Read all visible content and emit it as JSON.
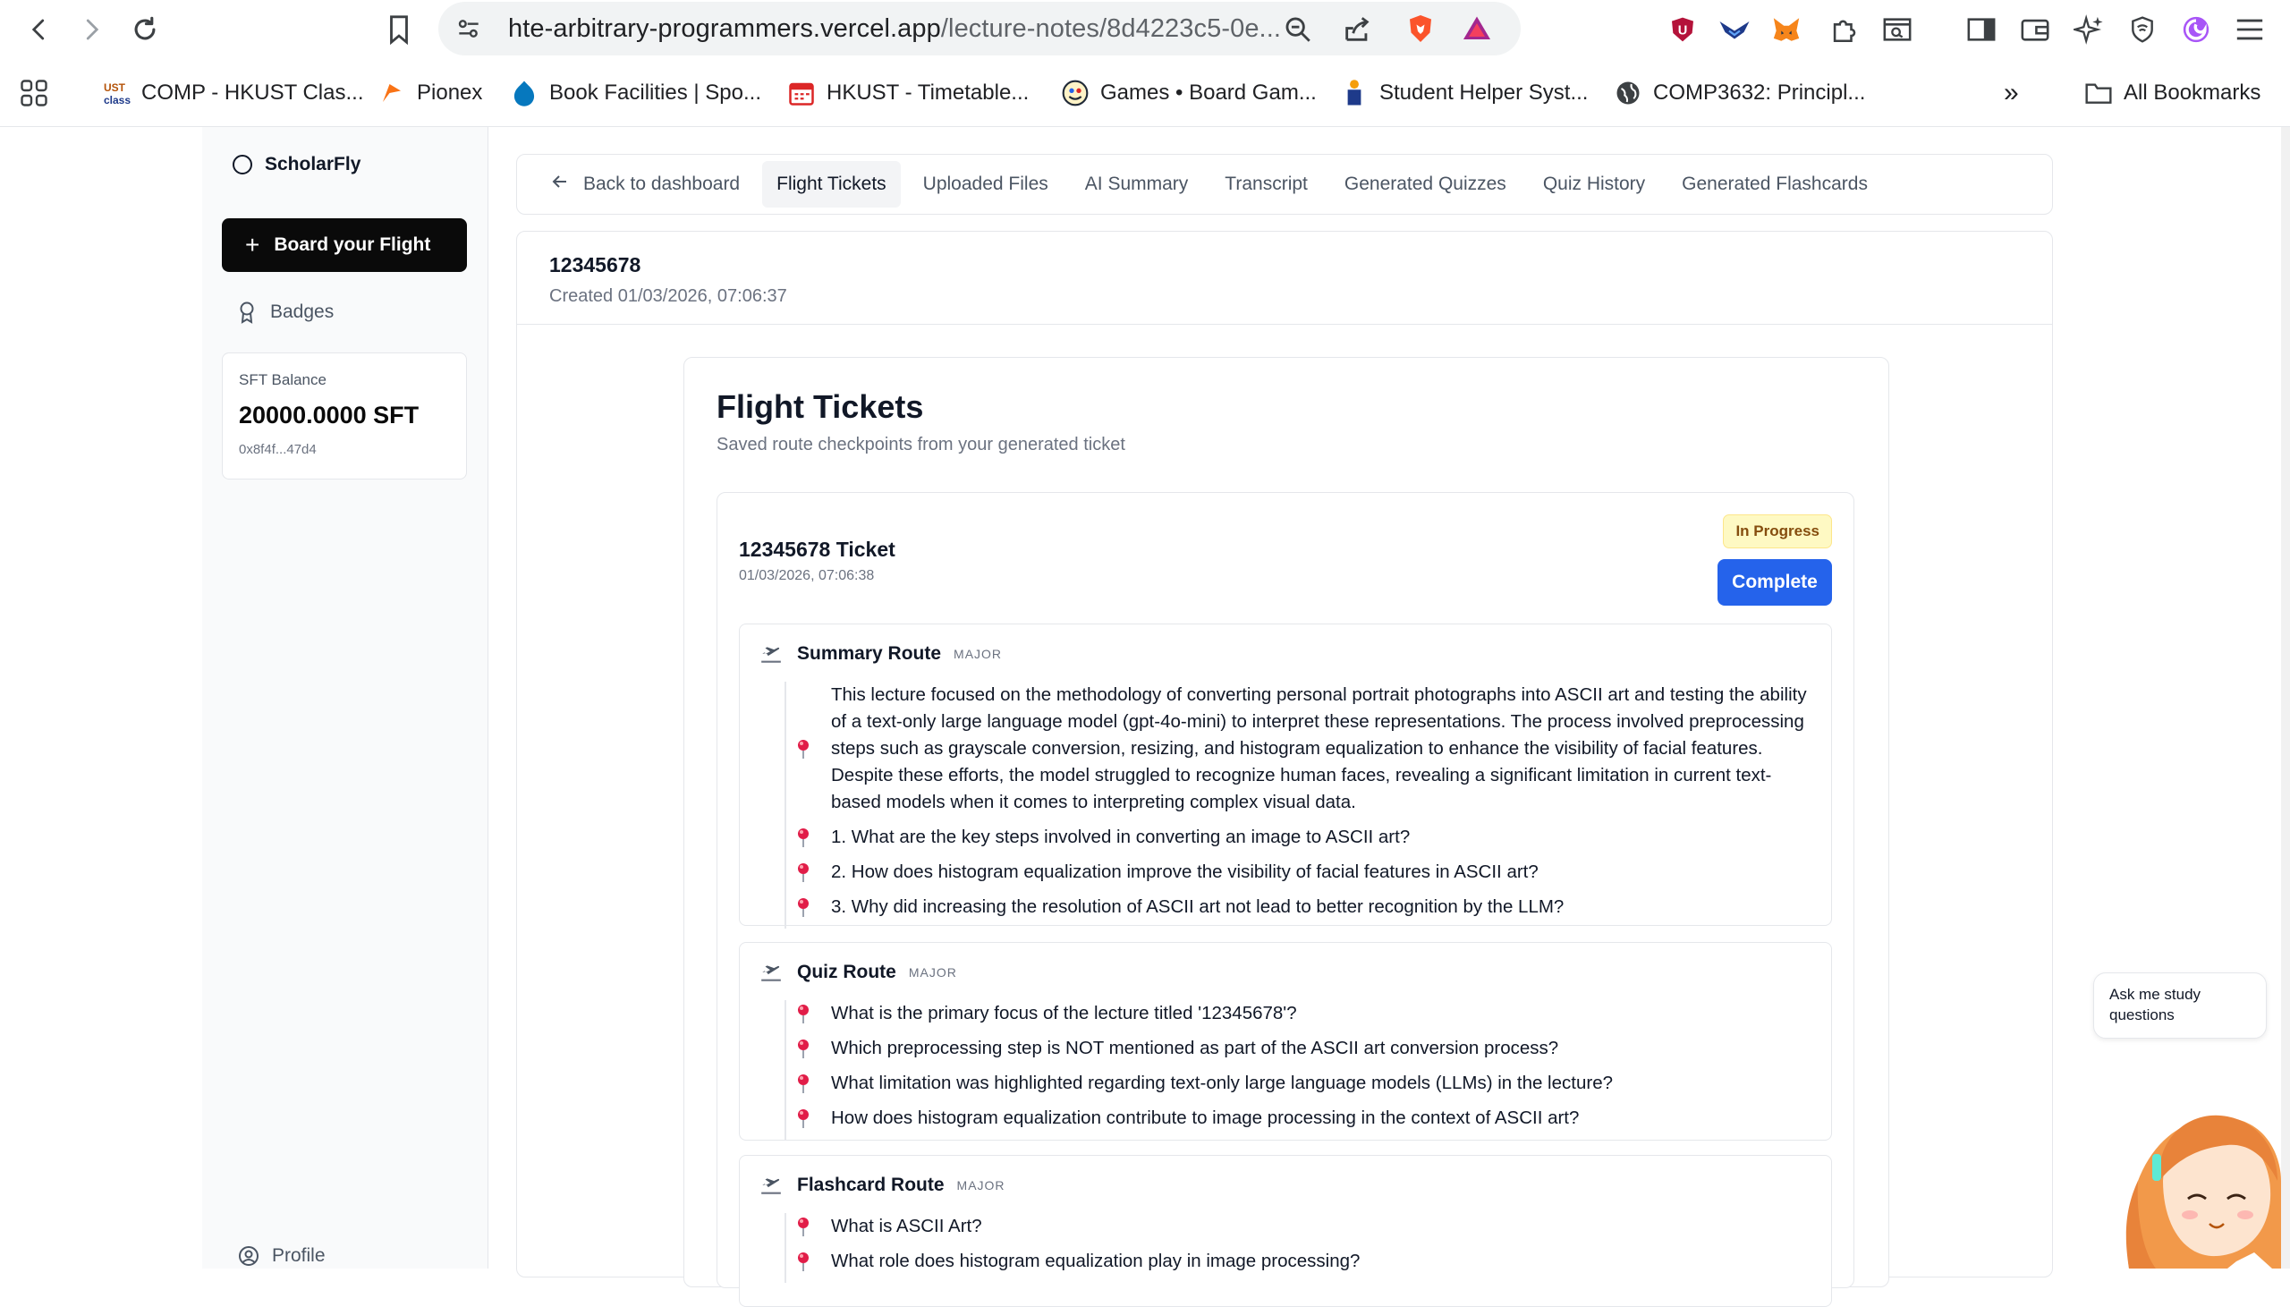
{
  "browser": {
    "url_host": "hte-arbitrary-programmers.vercel.app",
    "url_path": "/lecture-notes/8d4223c5-0e...",
    "bookmarks": [
      {
        "label": "COMP - HKUST Clas...",
        "icon": "ust-class-icon"
      },
      {
        "label": "Pionex",
        "icon": "pionex-icon"
      },
      {
        "label": "Book Facilities | Spo...",
        "icon": "drupal-icon"
      },
      {
        "label": "HKUST - Timetable...",
        "icon": "calendar-icon"
      },
      {
        "label": "Games • Board Gam...",
        "icon": "games-icon"
      },
      {
        "label": "Student Helper Syst...",
        "icon": "student-helper-icon"
      },
      {
        "label": "COMP3632: Principl...",
        "icon": "globe-icon"
      }
    ],
    "all_bookmarks": "All Bookmarks",
    "more": "»"
  },
  "sidebar": {
    "brand": "ScholarFly",
    "board_button": "Board your Flight",
    "board_plus": "+",
    "badges": "Badges",
    "balance_label": "SFT Balance",
    "balance_value": "20000.0000 SFT",
    "wallet": "0x8f4f...47d4",
    "profile": "Profile"
  },
  "tabs": {
    "back": "Back to dashboard",
    "items": [
      "Flight Tickets",
      "Uploaded Files",
      "AI Summary",
      "Transcript",
      "Generated Quizzes",
      "Quiz History",
      "Generated Flashcards"
    ]
  },
  "note": {
    "title": "12345678",
    "created": "Created 01/03/2026, 07:06:37"
  },
  "flight_tickets": {
    "title": "Flight Tickets",
    "subtitle": "Saved route checkpoints from your generated ticket",
    "ticket": {
      "title": "12345678 Ticket",
      "date": "01/03/2026, 07:06:38",
      "status": "In Progress",
      "complete_label": "Complete",
      "routes": [
        {
          "name": "Summary Route",
          "tag": "MAJOR",
          "checkpoints": [
            "This lecture focused on the methodology of converting personal portrait photographs into ASCII art and testing the ability of a text-only large language model (gpt-4o-mini) to interpret these representations. The process involved preprocessing steps such as grayscale conversion, resizing, and histogram equalization to enhance the visibility of facial features. Despite these efforts, the model struggled to recognize human faces, revealing a significant limitation in current text-based models when it comes to interpreting complex visual data.",
            "1. What are the key steps involved in converting an image to ASCII art?",
            "2. How does histogram equalization improve the visibility of facial features in ASCII art?",
            "3. Why did increasing the resolution of ASCII art not lead to better recognition by the LLM?"
          ]
        },
        {
          "name": "Quiz Route",
          "tag": "MAJOR",
          "checkpoints": [
            "What is the primary focus of the lecture titled '12345678'?",
            "Which preprocessing step is NOT mentioned as part of the ASCII art conversion process?",
            "What limitation was highlighted regarding text-only large language models (LLMs) in the lecture?",
            "How does histogram equalization contribute to image processing in the context of ASCII art?"
          ]
        },
        {
          "name": "Flashcard Route",
          "tag": "MAJOR",
          "checkpoints": [
            "What is ASCII Art?",
            "What role does histogram equalization play in image processing?"
          ]
        }
      ]
    }
  },
  "assistant": {
    "bubble": "Ask me study questions"
  },
  "colors": {
    "primary_button": "#2563eb",
    "board_button": "#0a0a0a",
    "status_bg": "#fef9c3",
    "pin": "#e11d48"
  }
}
